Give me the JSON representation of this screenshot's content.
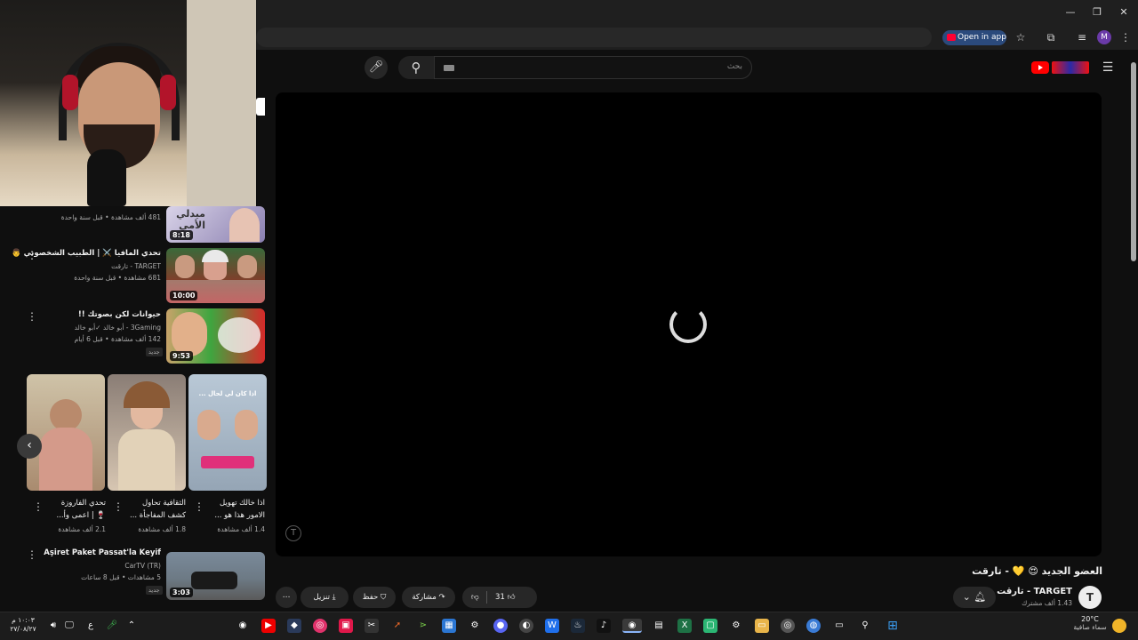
{
  "browser": {
    "open_in_app": "Open in app",
    "profile_initial": "M",
    "window_controls": [
      "minimize-icon",
      "restore-icon",
      "close-icon"
    ]
  },
  "header": {
    "search_placeholder": "بحث",
    "icons": [
      "mic-icon",
      "search-icon",
      "keyboard-icon",
      "youtube-logo-icon",
      "menu-icon"
    ]
  },
  "sidebar": {
    "top_item": {
      "meta": "481 ألف مشاهدة • قبل سنة واحدة",
      "duration": "8:18",
      "thumb_text": "ميدلي الأمي"
    },
    "videos": [
      {
        "title": "تحدي المافيا ⚔️ | الطبيب الشخصوني 👨",
        "channel": "TARGET - تارقت",
        "meta": "681 مشاهدة • قبل سنة واحدة",
        "duration": "10:00"
      },
      {
        "title": "حيوانات لكن بصوتك !!",
        "channel": "3Gaming - أبو خالد ✓أبو خالد",
        "meta": "142 ألف مشاهدة • قبل 6 أيام",
        "badge": "جديد",
        "duration": "9:53"
      },
      {
        "title": "Aşiret Paket Passat'la Keyif",
        "channel": "CarTV (TR)",
        "meta": "5 مشاهدات • قبل 8 ساعات",
        "badge": "جديد",
        "duration": "3:03"
      }
    ],
    "shorts": [
      {
        "line1": "اذا خالك تهويل",
        "line2": "الامور هذا هو ...",
        "views": "1.4 ألف مشاهدة",
        "thumb_text": "اذا كان لي لحال ..."
      },
      {
        "line1": "الثقافية تحاول",
        "line2": "كشف المفاجأة ...",
        "views": "1.8 ألف مشاهدة"
      },
      {
        "line1": "تحدي الفاروزة",
        "line2": "🍷 | اعمى وأ...",
        "views": "2.1 ألف مشاهدة"
      }
    ]
  },
  "player": {
    "watermark": "T"
  },
  "video": {
    "title": "العضو الجديد 😍 💛 - تارقت",
    "channel_name": "TARGET - تارقت",
    "subscribers": "1.43 ألف مشترك",
    "channel_avatar": "T",
    "likes": "31",
    "share_label": "مشاركة",
    "save_label": "حفظ",
    "download_label": "تنزيل"
  },
  "taskbar": {
    "temperature": "20°C",
    "weather": "سماء صافية",
    "time": "١٠:٠٣ م",
    "date": "٢٧/٠٨/٢٧",
    "lang": "ع"
  }
}
